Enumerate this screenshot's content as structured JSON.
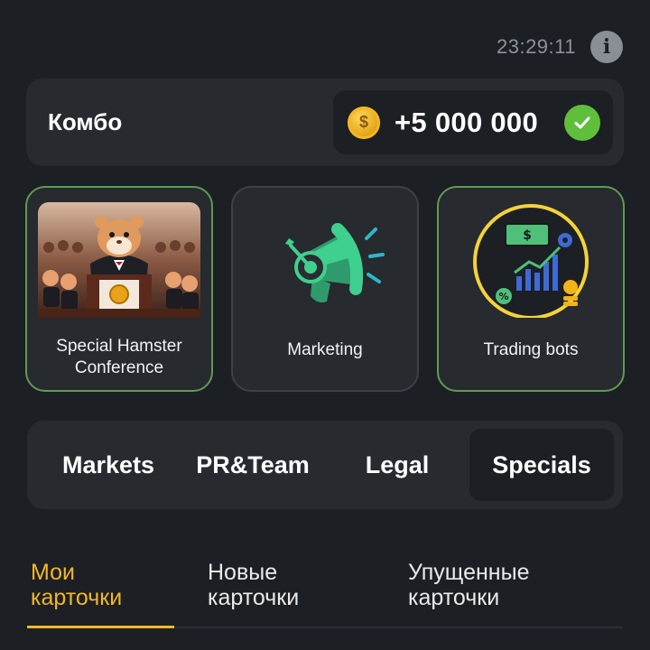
{
  "status": {
    "time": "23:29:11",
    "info_icon": "info-icon"
  },
  "combo": {
    "title": "Комбо",
    "coin_symbol": "$",
    "reward": "+5 000 000",
    "completed_icon": "check-icon"
  },
  "cards": [
    {
      "label_line1": "Special Hamster",
      "label_line2": "Conference",
      "completed": true,
      "image": "hamster-conference-image"
    },
    {
      "label_line1": "Marketing",
      "label_line2": "",
      "completed": false,
      "image": "megaphone-target-icon"
    },
    {
      "label_line1": "Trading bots",
      "label_line2": "",
      "completed": true,
      "image": "trading-bots-icon"
    }
  ],
  "categories": {
    "items": [
      "Markets",
      "PR&Team",
      "Legal",
      "Specials"
    ],
    "active": "Specials"
  },
  "card_tabs": {
    "items": [
      {
        "line1": "Мои",
        "line2": "карточки"
      },
      {
        "line1": "Новые",
        "line2": "карточки"
      },
      {
        "line1": "Упущенные",
        "line2": "карточки"
      }
    ],
    "active_index": 0
  },
  "colors": {
    "background": "#1c1f24",
    "panel": "#272a2f",
    "accent": "#f2b62a",
    "success": "#5fbf3b",
    "card_done_border": "#5d9c52"
  }
}
